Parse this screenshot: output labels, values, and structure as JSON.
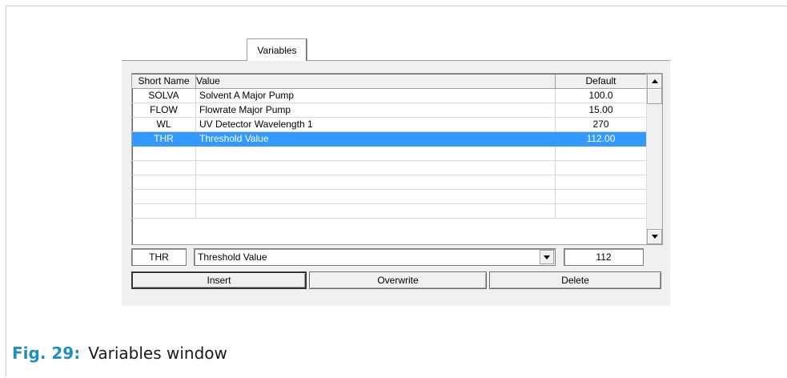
{
  "window": {
    "tab_label": "Variables"
  },
  "table": {
    "columns": [
      "Short Name",
      "Value",
      "Default"
    ],
    "rows": [
      {
        "short": "SOLVA",
        "value": "Solvent A Major Pump",
        "default": "100.0"
      },
      {
        "short": "FLOW",
        "value": "Flowrate Major Pump",
        "default": "15.00"
      },
      {
        "short": "WL",
        "value": "UV Detector Wavelength 1",
        "default": "270"
      },
      {
        "short": "THR",
        "value": "Threshold Value",
        "default": "112.00",
        "selected": true
      }
    ],
    "empty_rows": 5
  },
  "editor": {
    "short_name": "THR",
    "value": "Threshold Value",
    "default": "112"
  },
  "buttons": {
    "insert": "Insert",
    "overwrite": "Overwrite",
    "delete": "Delete"
  },
  "caption": {
    "number": "Fig. 29:",
    "text": "Variables window"
  },
  "colors": {
    "selection": "#3399ff",
    "caption_accent": "#1f8fbf"
  },
  "icons": {
    "scroll_up": "triangle-up",
    "scroll_down": "triangle-down",
    "combo": "triangle-down"
  }
}
